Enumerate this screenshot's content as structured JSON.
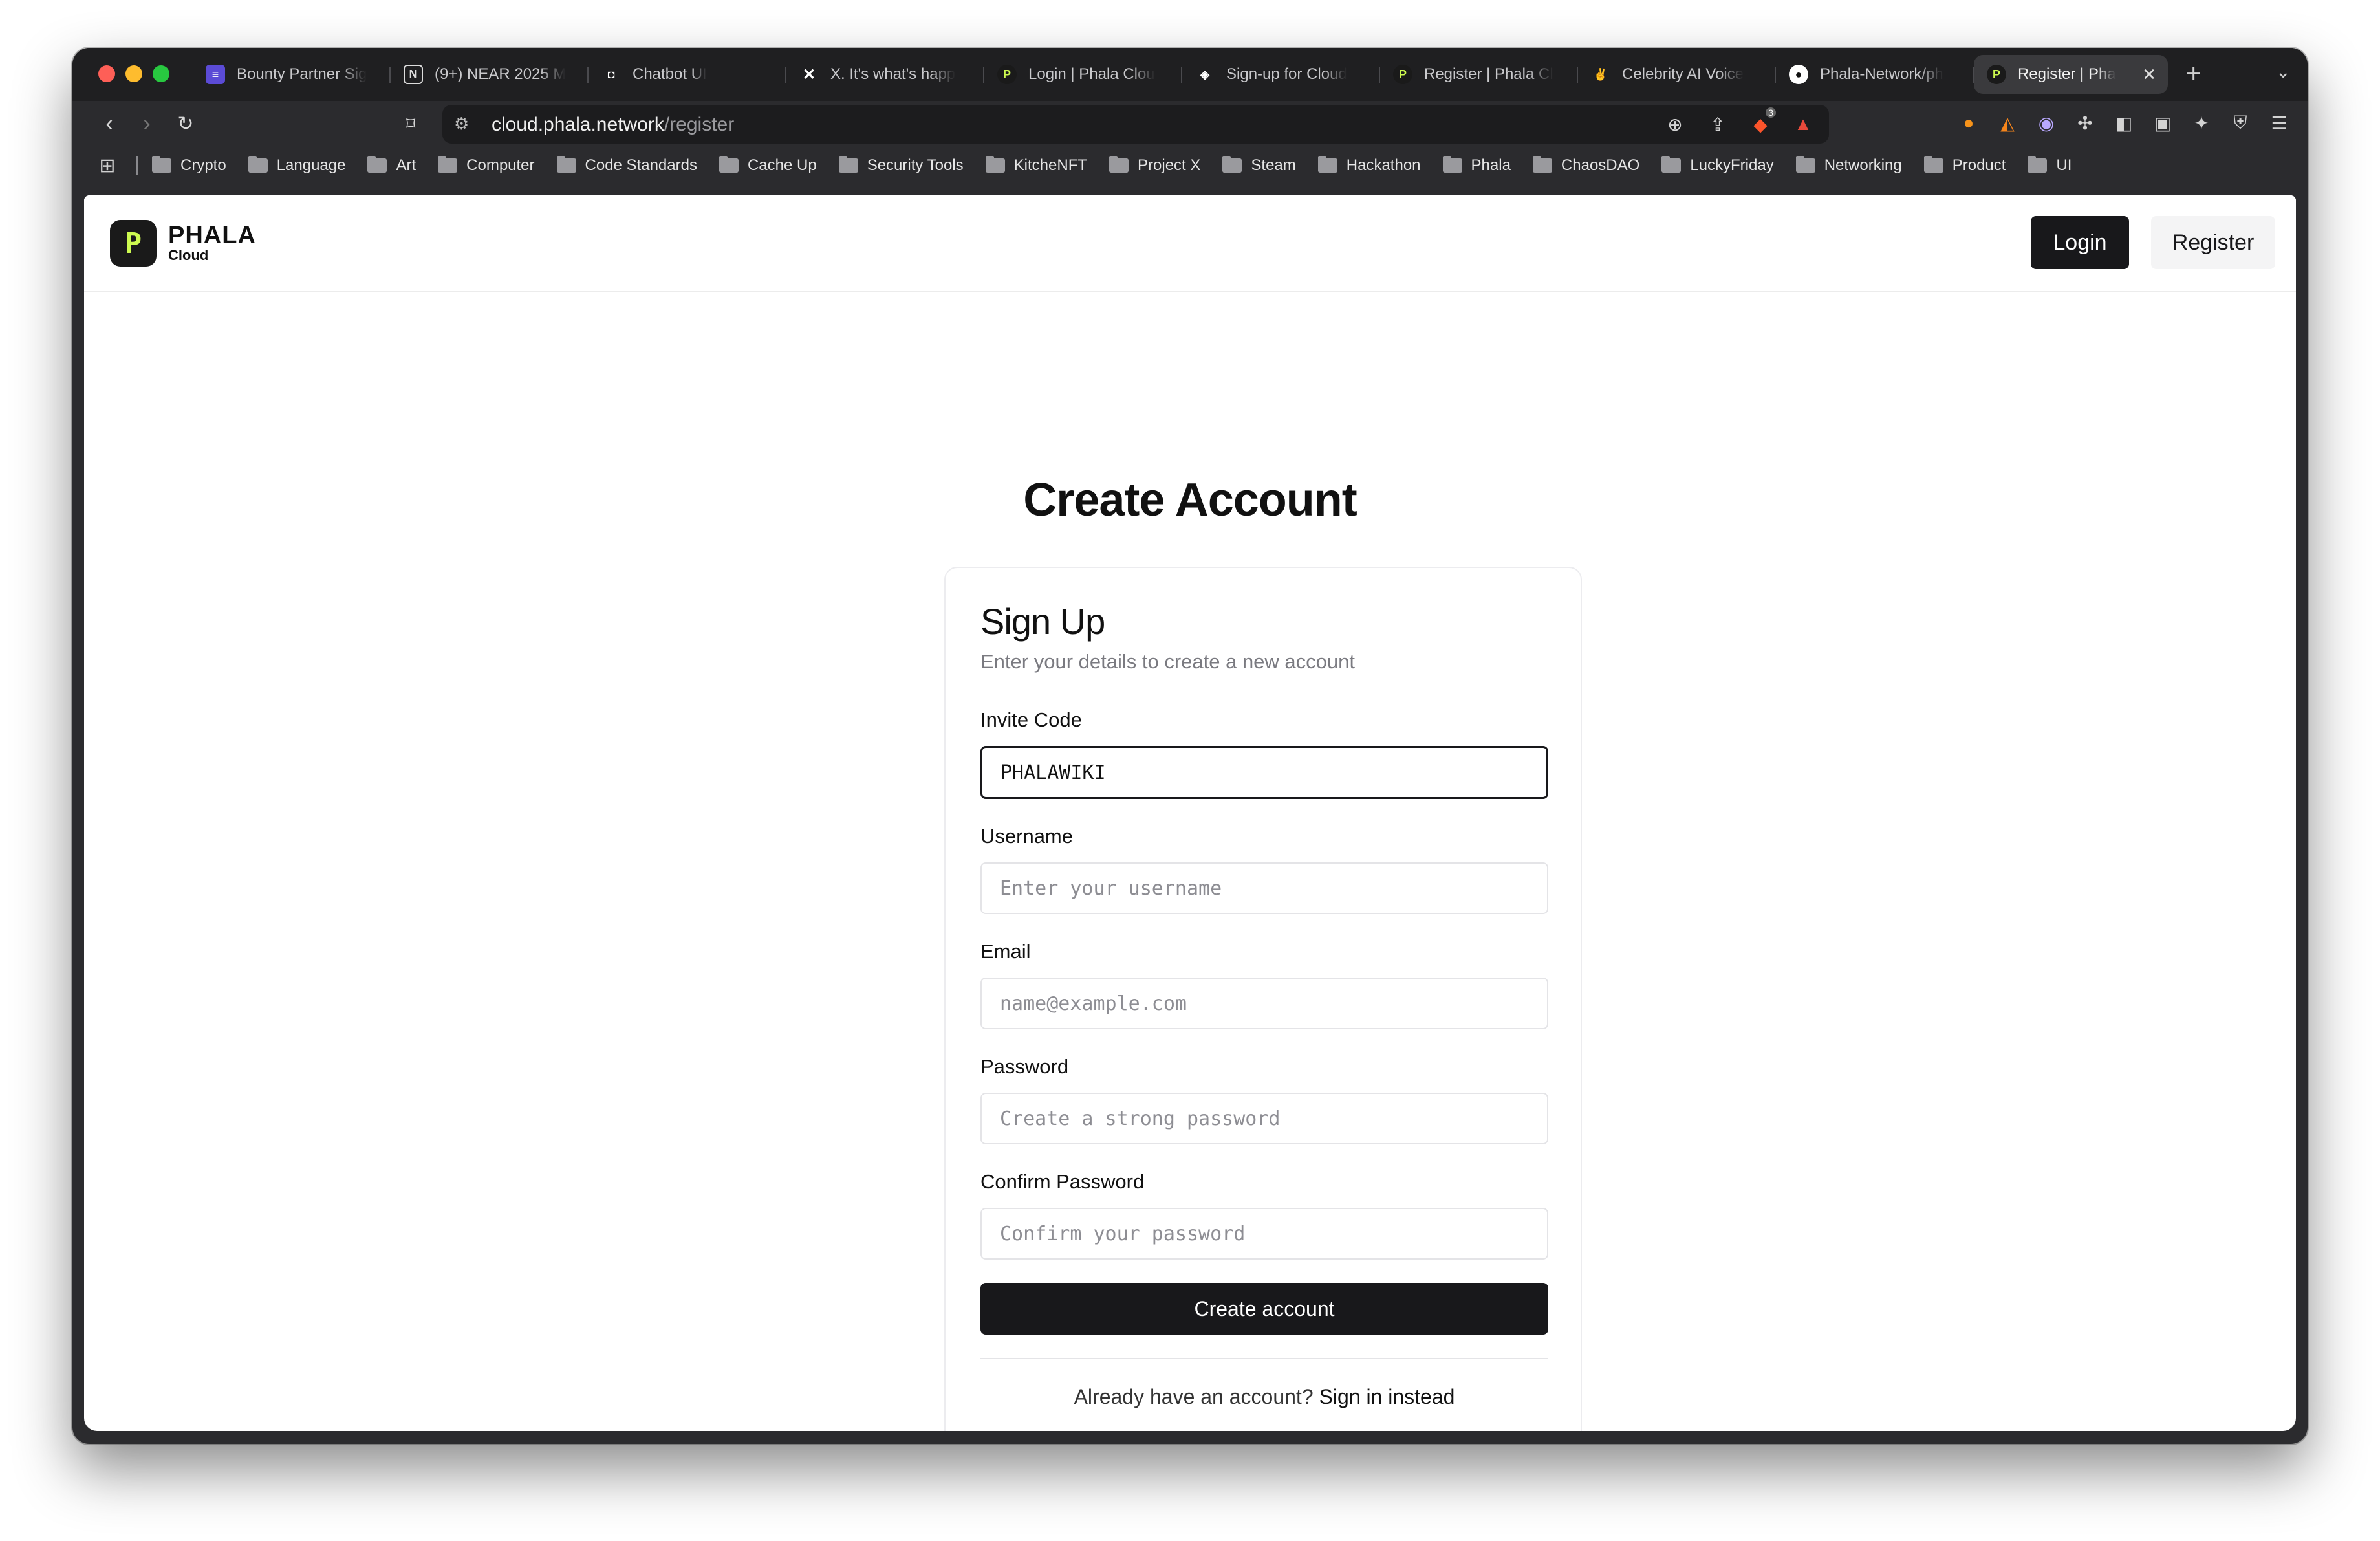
{
  "browser": {
    "tabs": [
      {
        "label": "Bounty Partner Sig",
        "icon": "form-icon",
        "color": "#5b4bd6"
      },
      {
        "label": "(9+) NEAR 2025 M",
        "icon": "notion-icon",
        "color": "#ffffff"
      },
      {
        "label": "Chatbot UI",
        "icon": "chat-icon",
        "color": "#ffffff"
      },
      {
        "label": "X. It's what's happ",
        "icon": "x-icon",
        "color": "#ffffff"
      },
      {
        "label": "Login | Phala Clou",
        "icon": "phala-icon",
        "color": "#cdfa50"
      },
      {
        "label": "Sign-up for Cloud",
        "icon": "layers-icon",
        "color": "#ffffff"
      },
      {
        "label": "Register | Phala Cl",
        "icon": "phala-icon",
        "color": "#cdfa50"
      },
      {
        "label": "Celebrity AI Voice",
        "icon": "hand-icon",
        "color": "#f5c26b"
      },
      {
        "label": "Phala-Network/ph",
        "icon": "github-icon",
        "color": "#ffffff"
      },
      {
        "label": "Register | Pha",
        "icon": "phala-icon",
        "color": "#cdfa50",
        "active": true
      }
    ],
    "address": {
      "host": "cloud.phala.network",
      "path": "/register"
    },
    "bookmarks": [
      "Crypto",
      "Language",
      "Art",
      "Computer",
      "Code Standards",
      "Cache Up",
      "Security Tools",
      "KitcheNFT",
      "Project X",
      "Steam",
      "Hackathon",
      "Phala",
      "ChaosDAO",
      "LuckyFriday",
      "Networking",
      "Product",
      "UI"
    ],
    "brave_badge": "3"
  },
  "header": {
    "logo_main": "PHALA",
    "logo_sub": "Cloud",
    "logo_mark": "P",
    "login_label": "Login",
    "register_label": "Register"
  },
  "page": {
    "title": "Create Account"
  },
  "form": {
    "title": "Sign Up",
    "subtitle": "Enter your details to create a new account",
    "fields": [
      {
        "label": "Invite Code",
        "value": "PHALAWIKI",
        "placeholder": ""
      },
      {
        "label": "Username",
        "value": "",
        "placeholder": "Enter your username"
      },
      {
        "label": "Email",
        "value": "",
        "placeholder": "name@example.com"
      },
      {
        "label": "Password",
        "value": "",
        "placeholder": "Create a strong password"
      },
      {
        "label": "Confirm Password",
        "value": "",
        "placeholder": "Confirm your password"
      }
    ],
    "submit_label": "Create account",
    "signin_prompt": "Already have an account?",
    "signin_link": "Sign in instead"
  },
  "colors": {
    "accent": "#18181b",
    "brand_green": "#cdfa50"
  }
}
